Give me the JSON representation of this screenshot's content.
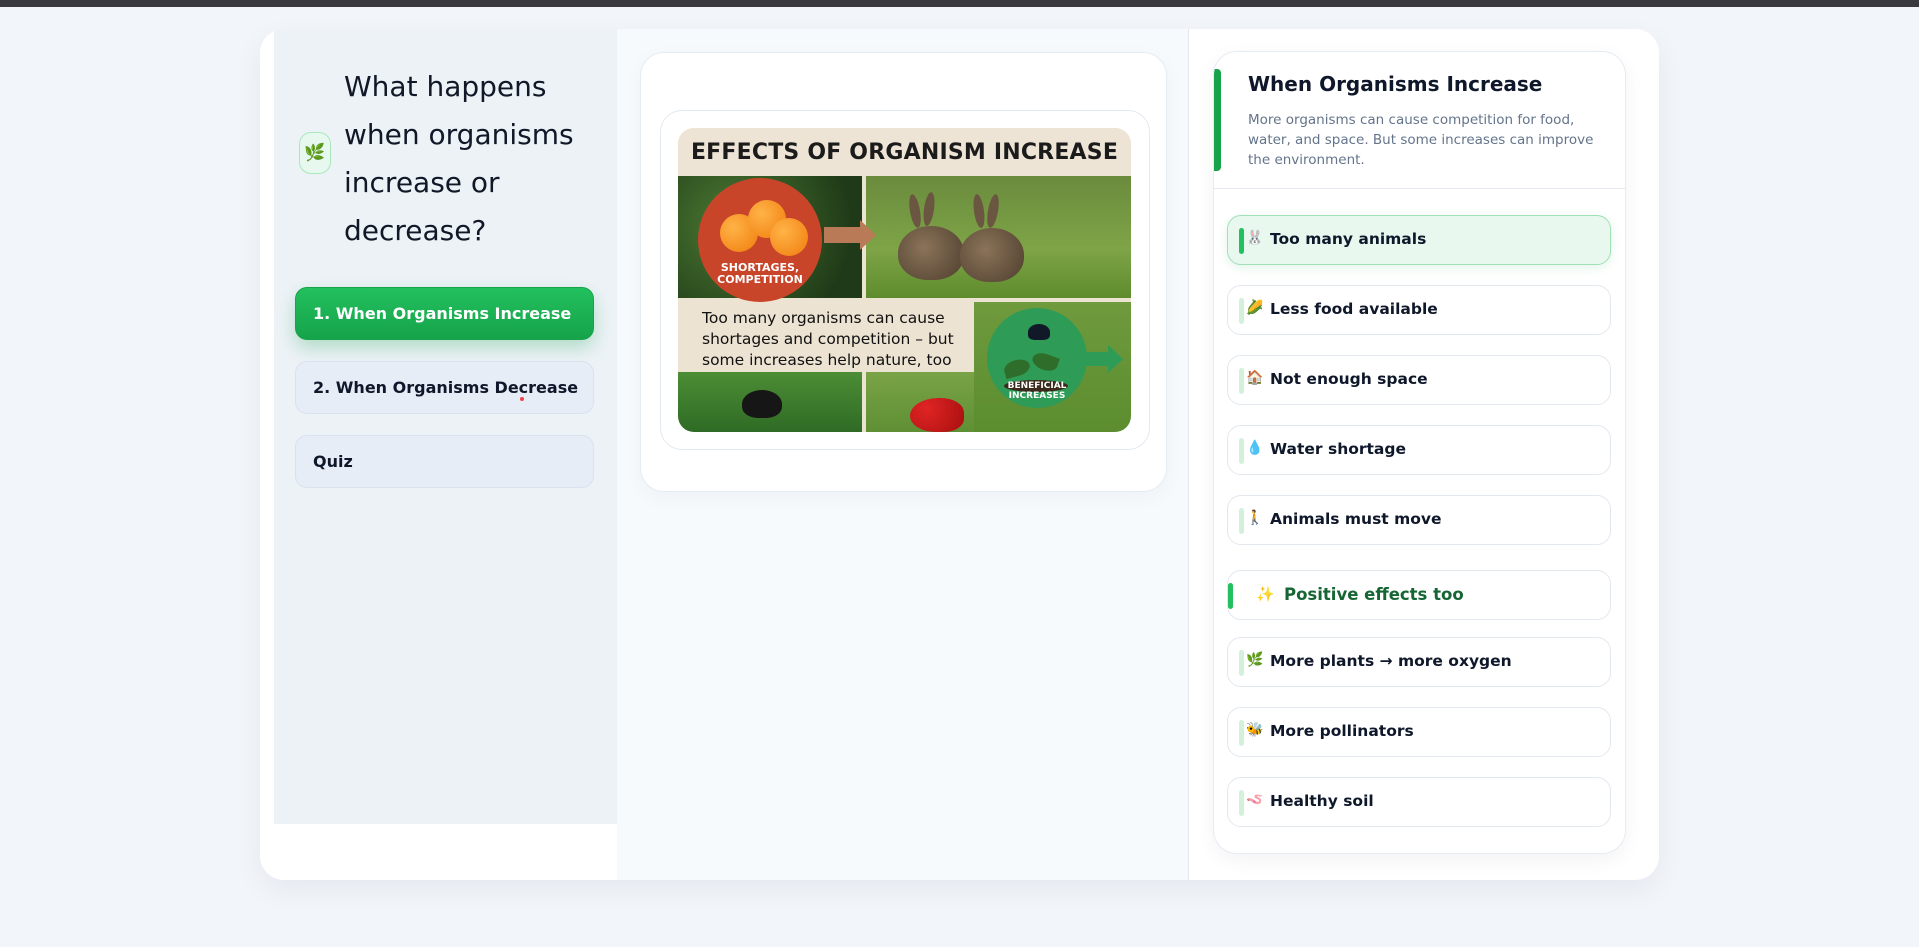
{
  "sidebar": {
    "icon": "herb-icon",
    "title": "What happens when organisms increase or decrease?",
    "nav": [
      {
        "label": "1. When Organisms Increase",
        "active": true
      },
      {
        "label": "2. When Organisms Decrease",
        "active": false
      },
      {
        "label": "Quiz",
        "active": false
      }
    ]
  },
  "poster": {
    "title": "EFFECTS OF ORGANISM INCREASE",
    "left_circle_label": "SHORTAGES, COMPETITION",
    "caption": "Too many organisms can cause shortages and competition – but some increases help nature, too",
    "right_circle_label": "BENEFICIAL INCREASES"
  },
  "panel": {
    "title": "When Organisms Increase",
    "description": "More organisms can cause competition for food, water, and space. But some increases can improve the environment.",
    "items": [
      {
        "icon": "🐰",
        "label": "Too many animals",
        "active": true
      },
      {
        "icon": "🌽",
        "label": "Less food available",
        "active": false
      },
      {
        "icon": "🏠",
        "label": "Not enough space",
        "active": false
      },
      {
        "icon": "💧",
        "label": "Water shortage",
        "active": false
      },
      {
        "icon": "🚶",
        "label": "Animals must move",
        "active": false
      }
    ],
    "section": {
      "icon": "✨",
      "label": "Positive effects too"
    },
    "positive_items": [
      {
        "icon": "🌿",
        "label": "More plants → more oxygen"
      },
      {
        "icon": "🐝",
        "label": "More pollinators"
      },
      {
        "icon": "🪱",
        "label": "Healthy soil"
      }
    ]
  },
  "colors": {
    "accent": "#16a34a",
    "accent_light": "#22c05e",
    "background": "#f2f6fb"
  }
}
